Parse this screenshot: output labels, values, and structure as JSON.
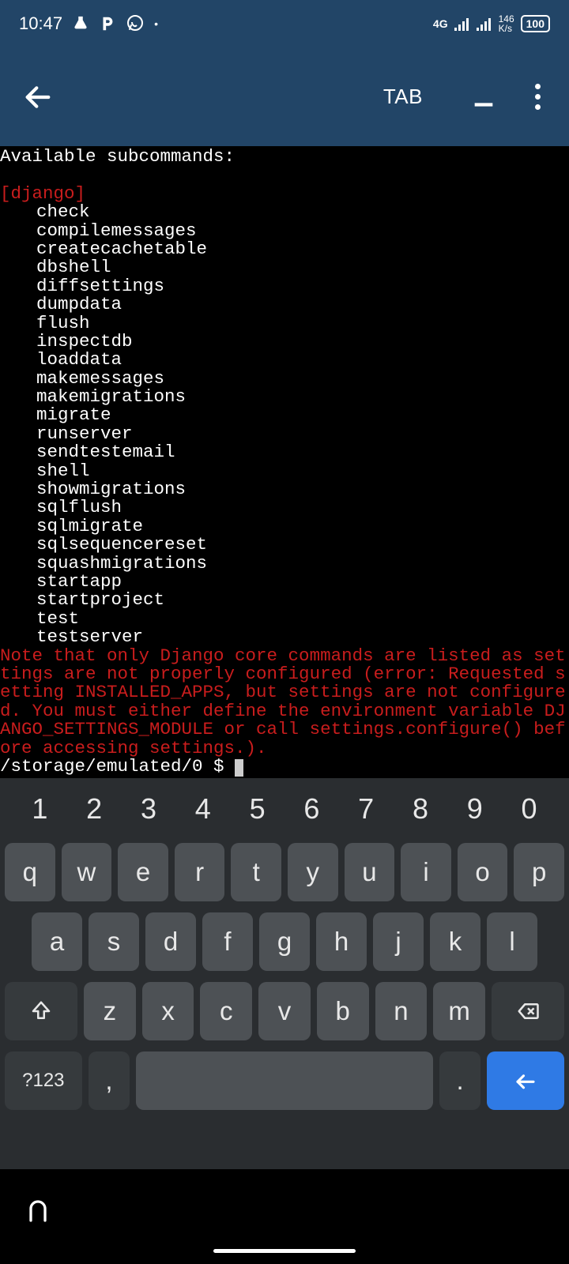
{
  "status": {
    "time": "10:47",
    "network_type": "4G",
    "speed": "146",
    "speed_unit": "K/s",
    "battery": "100"
  },
  "appbar": {
    "tab_label": "TAB"
  },
  "terminal": {
    "heading": "Available subcommands:",
    "section": "[django]",
    "commands": [
      "check",
      "compilemessages",
      "createcachetable",
      "dbshell",
      "diffsettings",
      "dumpdata",
      "flush",
      "inspectdb",
      "loaddata",
      "makemessages",
      "makemigrations",
      "migrate",
      "runserver",
      "sendtestemail",
      "shell",
      "showmigrations",
      "sqlflush",
      "sqlmigrate",
      "sqlsequencereset",
      "squashmigrations",
      "startapp",
      "startproject",
      "test",
      "testserver"
    ],
    "note": "Note that only Django core commands are listed as settings are not properly configured (error: Requested setting INSTALLED_APPS, but settings are not configured. You must either define the environment variable DJANGO_SETTINGS_MODULE or call settings.configure() before accessing settings.).",
    "prompt_path": "/storage/emulated/0 $ "
  },
  "keyboard": {
    "row_numbers": [
      "1",
      "2",
      "3",
      "4",
      "5",
      "6",
      "7",
      "8",
      "9",
      "0"
    ],
    "row_q": [
      "q",
      "w",
      "e",
      "r",
      "t",
      "y",
      "u",
      "i",
      "o",
      "p"
    ],
    "row_a": [
      "a",
      "s",
      "d",
      "f",
      "g",
      "h",
      "j",
      "k",
      "l"
    ],
    "row_z": [
      "z",
      "x",
      "c",
      "v",
      "b",
      "n",
      "m"
    ],
    "symbols_label": "?123",
    "comma": ",",
    "period": "."
  }
}
